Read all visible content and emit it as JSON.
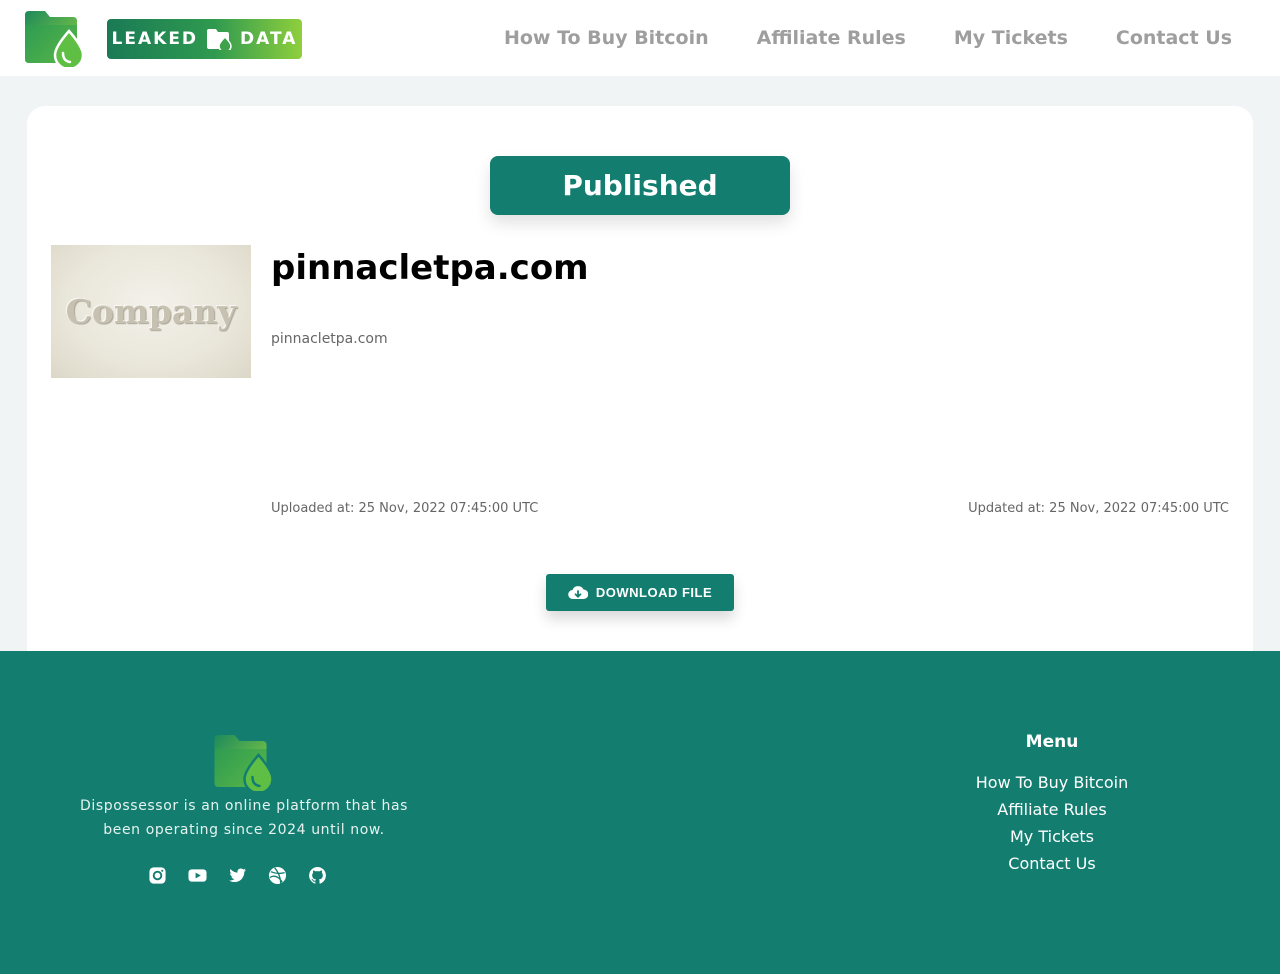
{
  "header": {
    "logo_text_left": "LEAKED",
    "logo_text_right": "DATA",
    "nav": [
      {
        "label": "How To Buy Bitcoin"
      },
      {
        "label": "Affiliate Rules"
      },
      {
        "label": "My Tickets"
      },
      {
        "label": "Contact Us"
      }
    ]
  },
  "post": {
    "status": "Published",
    "thumbnail_text": "Company",
    "title": "pinnacletpa.com",
    "subtitle": "pinnacletpa.com",
    "uploaded": "Uploaded at: 25 Nov, 2022 07:45:00 UTC",
    "updated": "Updated at: 25 Nov, 2022 07:45:00 UTC",
    "download_label": "DOWNLOAD FILE"
  },
  "footer": {
    "description": "Dispossessor is an online platform that has been operating since 2024 until now.",
    "socials": [
      "instagram-icon",
      "youtube-icon",
      "twitter-icon",
      "dribbble-icon",
      "github-icon"
    ],
    "menu_title": "Menu",
    "menu": [
      {
        "label": "How To Buy Bitcoin"
      },
      {
        "label": "Affiliate Rules"
      },
      {
        "label": "My Tickets"
      },
      {
        "label": "Contact Us"
      }
    ]
  },
  "colors": {
    "primary": "#137e70",
    "background": "#f1f4f5",
    "nav_text": "#9e9e9e"
  }
}
